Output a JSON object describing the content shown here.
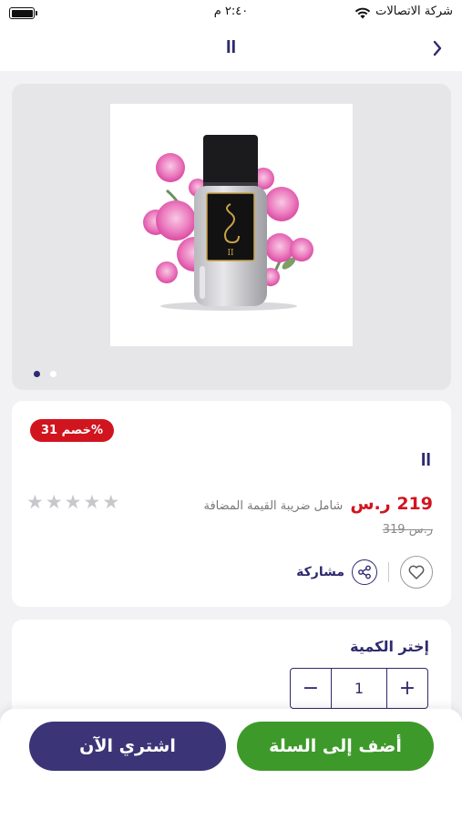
{
  "status_bar": {
    "carrier": "شركة الاتصالات",
    "time": "٢:٤٠ م"
  },
  "nav": {
    "title": "II",
    "back_icon": "chevron-right-icon"
  },
  "gallery": {
    "image_alt": "II perfume bottle with pink flowers",
    "bottle_label": "II",
    "page_count": 2,
    "active_page": 1
  },
  "product": {
    "discount_badge": "خصم 31%",
    "name": "II",
    "price": "219 ر.س",
    "vat_note": "شامل ضريبة القيمة المضافة",
    "old_price": "319 ر.س",
    "rating": 0,
    "rating_max": 5,
    "share_label": "مشاركة"
  },
  "quantity": {
    "title": "إختر الكمية",
    "value": "1",
    "plus": "+",
    "minus": "−"
  },
  "bottom": {
    "add_to_cart": "أضف إلى السلة",
    "buy_now": "اشتري الآن"
  },
  "colors": {
    "brand_navy": "#2e2a6e",
    "discount_red": "#d1151f",
    "cart_green": "#3d9a2a",
    "buy_purple": "#3b3577"
  }
}
